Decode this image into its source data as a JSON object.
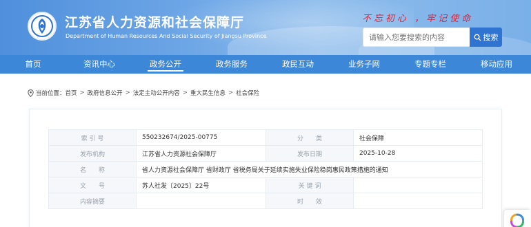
{
  "header": {
    "title": "江苏省人力资源和社会保障厅",
    "subtitle": "Department of Human Resources And Social Security of Jiangsu Province",
    "slogan": "不忘初心 ，牢记使命",
    "logo_icon": "emblem-icon",
    "search": {
      "placeholder": "请输入您要搜索的内容",
      "button_label": "搜索",
      "button_icon": "search-icon"
    }
  },
  "nav": {
    "items": [
      {
        "label": "首页"
      },
      {
        "label": "资讯中心"
      },
      {
        "label": "政务公开"
      },
      {
        "label": "政务服务"
      },
      {
        "label": "政民互动"
      },
      {
        "label": "业务子网"
      },
      {
        "label": "专题专栏"
      },
      {
        "label": "移动应用"
      }
    ],
    "active_index": 2
  },
  "breadcrumb": {
    "prefix": "当前位置：",
    "icon": "location-pin-icon",
    "items": [
      "首页",
      "政府信息公开",
      "法定主动公开内容",
      "重大民生信息",
      "社会保险"
    ],
    "separator": ">"
  },
  "meta_table": {
    "rows": [
      {
        "l1": "索 引 号",
        "v1": "550232674/2025-00775",
        "l2": "分　　类",
        "v2": "社会保障"
      },
      {
        "l1": "发布机构",
        "v1": "江苏省人力资源社会保障厅",
        "l2": "发布日期",
        "v2": "2025-10-28"
      },
      {
        "l1": "名　　称",
        "v1": "省人力资源社会保障厅 省财政厅 省税务局关于延续实施失业保险稳岗惠民政策措施的通知"
      },
      {
        "l1": "文　　号",
        "v1": "苏人社发〔2025〕22号",
        "l2": "关 键 词",
        "v2": ""
      },
      {
        "l1": "内容摘要",
        "v1": "",
        "l2": "时　　效",
        "v2": ""
      }
    ]
  },
  "widget": {
    "icon": "app-logo-icon"
  },
  "colors": {
    "nav_bg": "#3d87d8",
    "search_button": "#2f74d0",
    "slogan": "#d7263d"
  }
}
